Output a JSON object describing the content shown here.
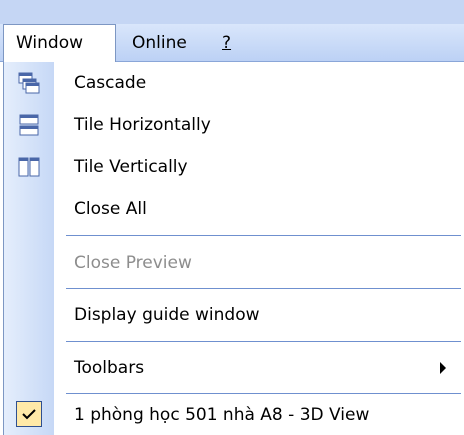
{
  "menubar": {
    "window": "Window",
    "online": "Online",
    "help": "?"
  },
  "menu": {
    "cascade": "Cascade",
    "tile_horizontally": "Tile Horizontally",
    "tile_vertically": "Tile Vertically",
    "close_all": "Close All",
    "close_preview": "Close Preview",
    "display_guide_window": "Display guide window",
    "toolbars": "Toolbars",
    "open_window_1": "1 phòng học 501 nhà A8 - 3D View"
  },
  "colors": {
    "menubar_bg": "#c5d6f4",
    "gutter": "#c6d8f6",
    "separator": "#6f90cf",
    "checked_bg": "#ffe9a8"
  },
  "icons": [
    "cascade-icon",
    "tile-horizontal-icon",
    "tile-vertical-icon",
    "checkmark-icon",
    "submenu-arrow-icon"
  ]
}
